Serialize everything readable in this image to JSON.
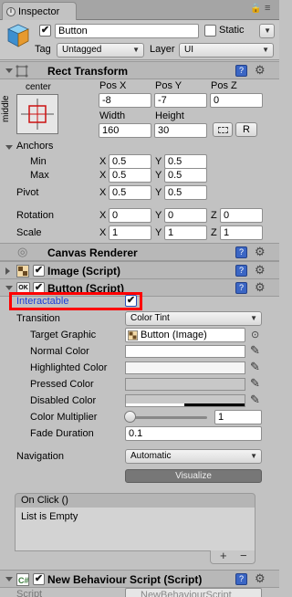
{
  "tab": {
    "label": "Inspector"
  },
  "gameobject": {
    "name": "Button",
    "static_label": "Static",
    "tag_label": "Tag",
    "tag_value": "Untagged",
    "layer_label": "Layer",
    "layer_value": "UI"
  },
  "rect_transform": {
    "title": "Rect Transform",
    "anchor_h": "center",
    "anchor_v": "middle",
    "pos_x_label": "Pos X",
    "pos_y_label": "Pos Y",
    "pos_z_label": "Pos Z",
    "pos_x": "-8",
    "pos_y": "-7",
    "pos_z": "0",
    "width_label": "Width",
    "height_label": "Height",
    "width": "160",
    "height": "30",
    "r_button": "R",
    "anchors_label": "Anchors",
    "min_label": "Min",
    "max_label": "Max",
    "min_x": "0.5",
    "min_y": "0.5",
    "max_x": "0.5",
    "max_y": "0.5",
    "pivot_label": "Pivot",
    "pivot_x": "0.5",
    "pivot_y": "0.5",
    "rotation_label": "Rotation",
    "rot_x": "0",
    "rot_y": "0",
    "rot_z": "0",
    "scale_label": "Scale",
    "scale_x": "1",
    "scale_y": "1",
    "scale_z": "1",
    "x": "X",
    "y": "Y",
    "z": "Z"
  },
  "canvas_renderer": {
    "title": "Canvas Renderer"
  },
  "image_script": {
    "title": "Image (Script)"
  },
  "button_script": {
    "title": "Button (Script)",
    "interactable_label": "Interactable",
    "transition_label": "Transition",
    "transition_value": "Color Tint",
    "target_graphic_label": "Target Graphic",
    "target_graphic_value": "Button (Image)",
    "normal_color_label": "Normal Color",
    "highlighted_color_label": "Highlighted Color",
    "pressed_color_label": "Pressed Color",
    "disabled_color_label": "Disabled Color",
    "color_multiplier_label": "Color Multiplier",
    "color_multiplier_value": "1",
    "fade_duration_label": "Fade Duration",
    "fade_duration_value": "0.1",
    "navigation_label": "Navigation",
    "navigation_value": "Automatic",
    "visualize_label": "Visualize",
    "on_click_label": "On Click ()",
    "list_empty": "List is Empty",
    "add": "+",
    "remove": "−"
  },
  "new_behaviour": {
    "title": "New Behaviour Script (Script)",
    "script_label": "Script",
    "script_value": "NewBehaviourScript"
  },
  "colors": {
    "highlight_border": "#ff0000",
    "interactable_text": "#1c3fd6"
  }
}
